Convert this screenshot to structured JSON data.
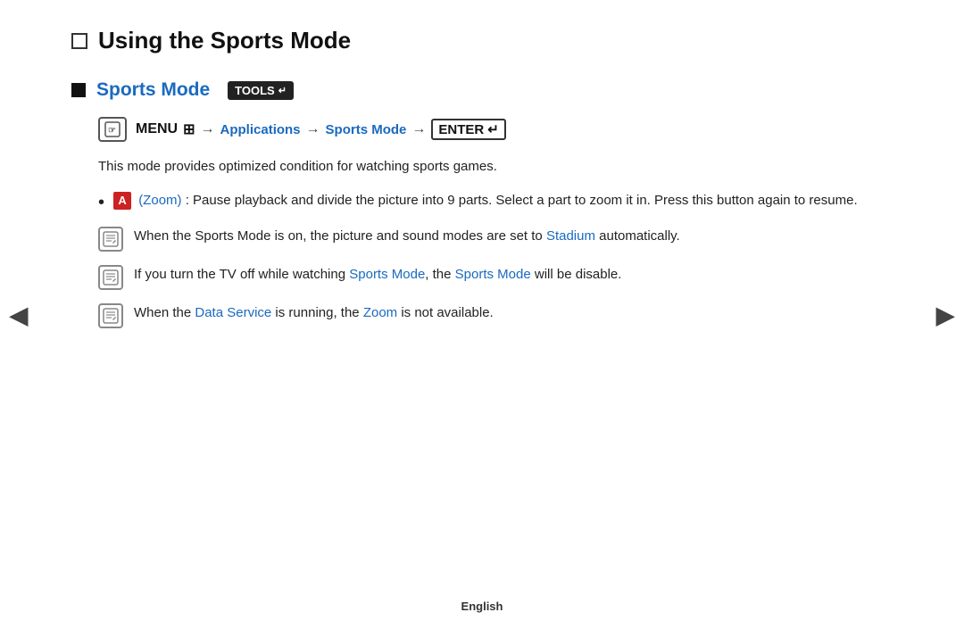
{
  "page": {
    "main_heading": "Using the Sports Mode",
    "section_heading": "Sports Mode",
    "tools_badge": "TOOLS",
    "menu_path": {
      "icon_label": "m",
      "menu_label": "MENU",
      "menu_symbol": "⊞",
      "arrow": "→",
      "app_link": "Applications",
      "sports_mode_link": "Sports Mode",
      "enter_label": "ENTER"
    },
    "body_text": "This mode provides optimized condition for watching sports games.",
    "bullet_zoom_label": "Zoom",
    "bullet_zoom_text": ": Pause playback and divide the picture into 9 parts. Select a part to zoom it in. Press this button again to resume.",
    "note1_text1": "When the Sports Mode is on, the picture and sound modes are set to ",
    "note1_link": "Stadium",
    "note1_text2": " automatically.",
    "note2_text1": "If you turn the TV off while watching ",
    "note2_link1": "Sports Mode",
    "note2_text2": ", the ",
    "note2_link2": "Sports Mode",
    "note2_text3": " will be disable.",
    "note3_text1": "When the ",
    "note3_link1": "Data Service",
    "note3_text2": " is running, the ",
    "note3_link2": "Zoom",
    "note3_text3": " is not available.",
    "footer": "English",
    "nav_left": "◀",
    "nav_right": "▶"
  }
}
